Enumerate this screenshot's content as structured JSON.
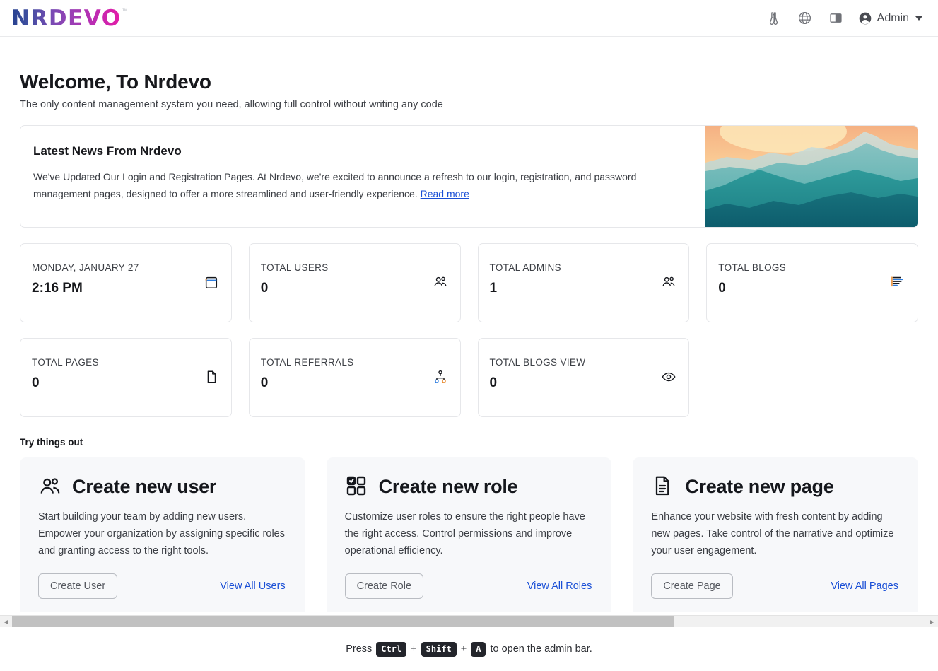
{
  "header": {
    "logo_text": "NRDEVO",
    "logo_tm": "™",
    "icons": [
      "binoculars-icon",
      "globe-icon",
      "panel-contrast-icon"
    ],
    "user_label": "Admin"
  },
  "welcome": {
    "title": "Welcome, To Nrdevo",
    "subtitle": "The only content management system you need, allowing full control without writing any code"
  },
  "news": {
    "title": "Latest News From Nrdevo",
    "body": "We've Updated Our Login and Registration Pages. At Nrdevo, we're excited to announce a refresh to our login, registration, and password management pages, designed to offer a more streamlined and user-friendly experience. ",
    "link_label": "Read more",
    "close_label": "×"
  },
  "stats": [
    {
      "label": "MONDAY, JANUARY 27",
      "value": "2:16 PM",
      "icon": "calendar-icon"
    },
    {
      "label": "TOTAL USERS",
      "value": "0",
      "icon": "users-icon"
    },
    {
      "label": "TOTAL ADMINS",
      "value": "1",
      "icon": "users-icon"
    },
    {
      "label": "TOTAL BLOGS",
      "value": "0",
      "icon": "article-lines-icon"
    },
    {
      "label": "TOTAL PAGES",
      "value": "0",
      "icon": "file-icon"
    },
    {
      "label": "TOTAL REFERRALS",
      "value": "0",
      "icon": "hierarchy-icon"
    },
    {
      "label": "TOTAL BLOGS VIEW",
      "value": "0",
      "icon": "eye-icon"
    }
  ],
  "try": {
    "heading": "Try things out",
    "cards": [
      {
        "title": "Create new user",
        "icon": "users-icon",
        "desc": "Start building your team by adding new users. Empower your organization by assigning specific roles and granting access to the right tools.",
        "button": "Create User",
        "link": "View All Users"
      },
      {
        "title": "Create new role",
        "icon": "checkbox-grid-icon",
        "desc": "Customize user roles to ensure the right people have the right access. Control permissions and improve operational efficiency.",
        "button": "Create Role",
        "link": "View All Roles"
      },
      {
        "title": "Create new page",
        "icon": "page-lines-icon",
        "desc": "Enhance your website with fresh content by adding new pages. Take control of the narrative and optimize your user engagement.",
        "button": "Create Page",
        "link": "View All Pages"
      }
    ]
  },
  "footer": {
    "press_text": "Press",
    "key1": "Ctrl",
    "plus1": "+",
    "key2": "Shift",
    "plus2": "+",
    "key3": "A",
    "tail_text": "to open the admin bar."
  },
  "colors": {
    "link": "#1a4fd6",
    "logo_start": "#27418f",
    "logo_end": "#e61ba6",
    "card_border": "#e6e7ea",
    "try_card_bg": "#f7f8fa"
  }
}
